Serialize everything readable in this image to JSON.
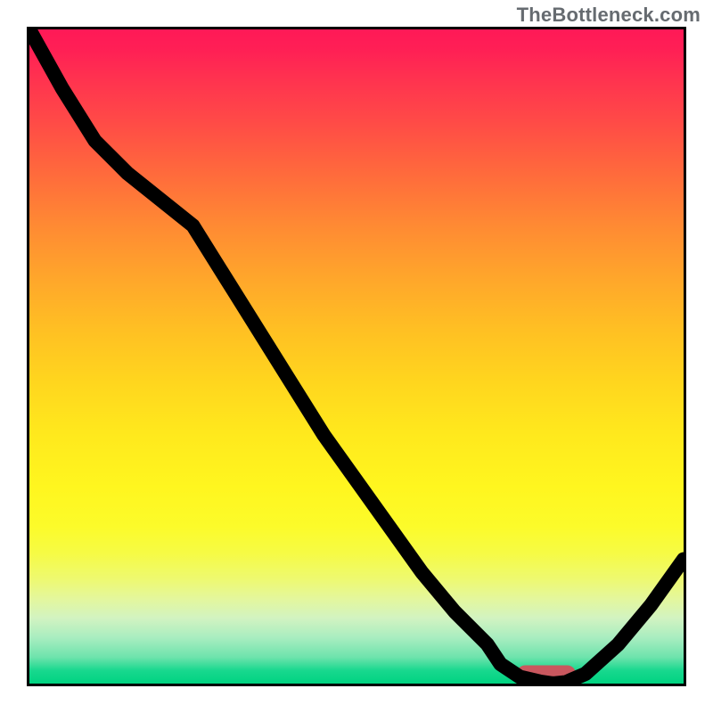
{
  "watermark": "TheBottleneck.com",
  "chart_data": {
    "type": "line",
    "x": [
      0,
      5,
      10,
      15,
      20,
      25,
      30,
      35,
      40,
      45,
      50,
      55,
      60,
      65,
      70,
      72,
      75,
      78,
      80,
      82,
      85,
      90,
      95,
      100
    ],
    "y": [
      100,
      91,
      83,
      78,
      74,
      70,
      62,
      54,
      46,
      38,
      31,
      24,
      17,
      11,
      6,
      3,
      1,
      0.3,
      0,
      0.2,
      1.5,
      6,
      12,
      19
    ],
    "xlabel": "",
    "ylabel": "",
    "xlim": [
      0,
      100
    ],
    "ylim": [
      0,
      100
    ],
    "title": "",
    "highlight": {
      "x_start": 75,
      "x_end": 83,
      "y": 0.8
    },
    "gradient_stops": [
      {
        "pos": 0,
        "color": "#ff1957"
      },
      {
        "pos": 50,
        "color": "#ffd61e"
      },
      {
        "pos": 80,
        "color": "#f6fb44"
      },
      {
        "pos": 100,
        "color": "#00d381"
      }
    ]
  }
}
